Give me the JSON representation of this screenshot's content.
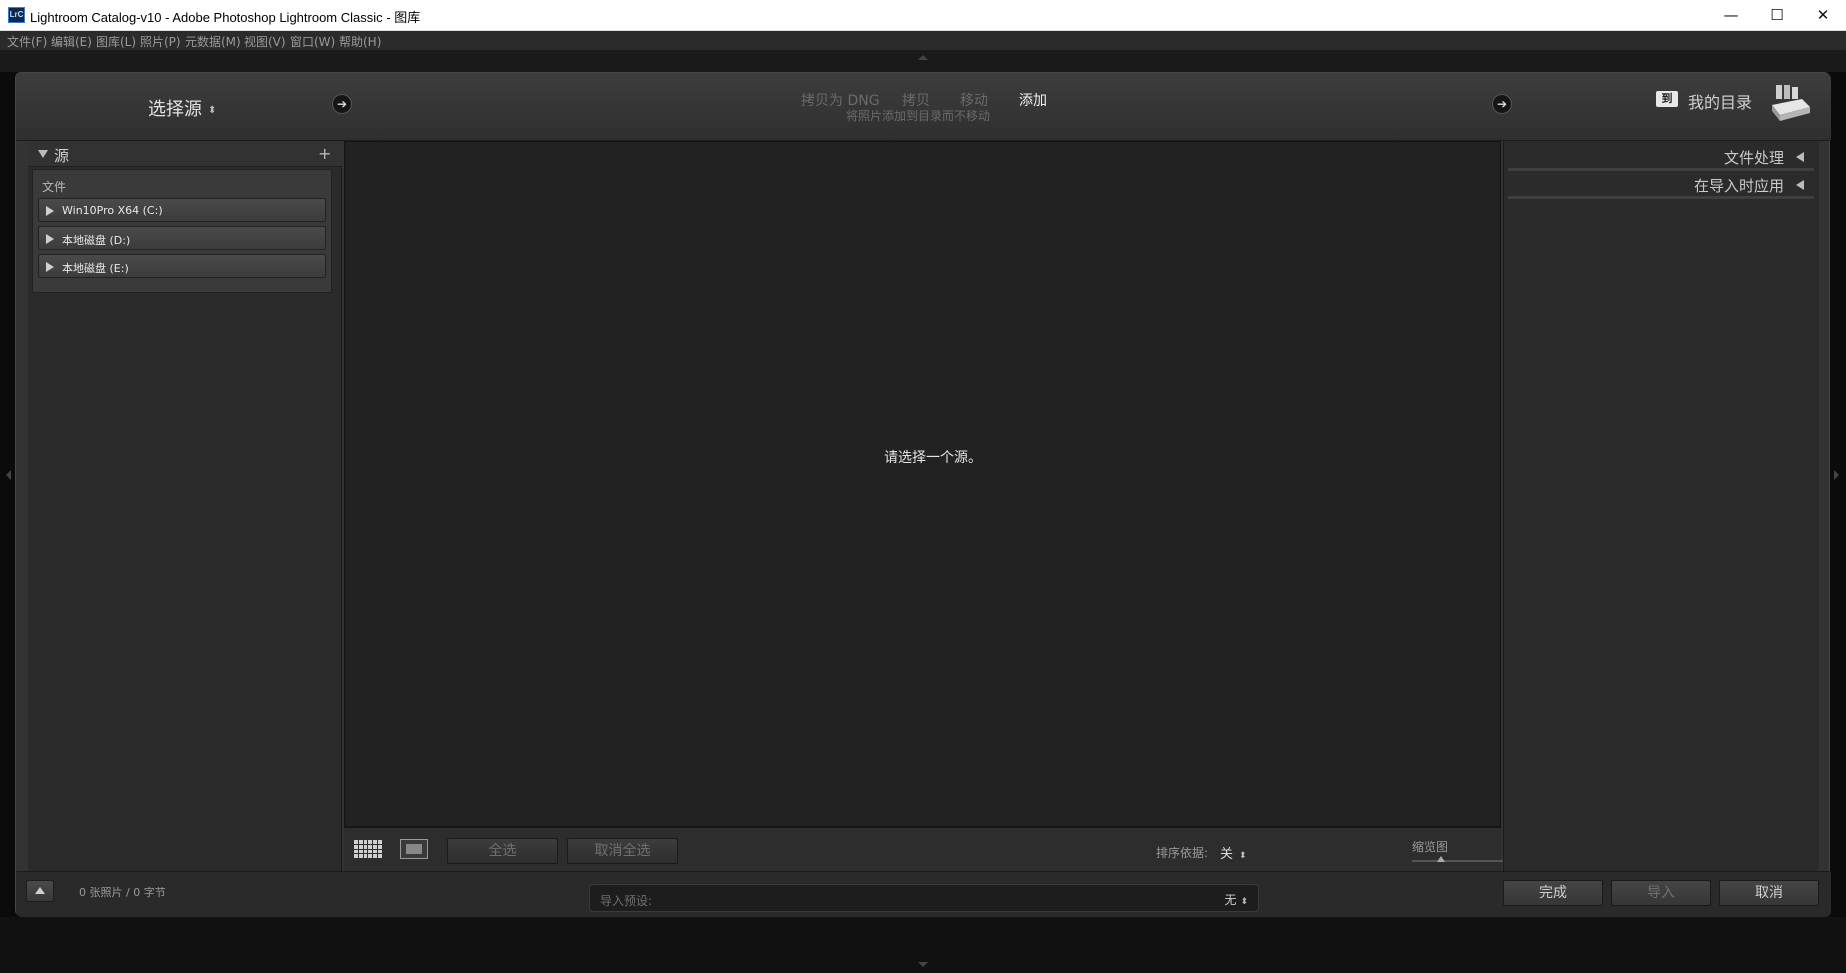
{
  "window": {
    "app_icon_text": "LrC",
    "title": "Lightroom Catalog-v10 - Adobe Photoshop Lightroom Classic - 图库",
    "minimize_glyph": "—",
    "maximize_glyph": "☐",
    "close_glyph": "✕"
  },
  "menu": [
    {
      "label": "文件(F)"
    },
    {
      "label": "编辑(E)"
    },
    {
      "label": "图库(L)"
    },
    {
      "label": "照片(P)"
    },
    {
      "label": "元数据(M)"
    },
    {
      "label": "视图(V)"
    },
    {
      "label": "窗口(W)"
    },
    {
      "label": "帮助(H)"
    }
  ],
  "header": {
    "source_title": "选择源",
    "source_updown": "⬍",
    "arrow_glyph": "➔",
    "modes": {
      "dng": "拷贝为 DNG",
      "copy": "拷贝",
      "move": "移动",
      "add": "添加"
    },
    "mode_description": "将照片添加到目录而不移动",
    "catalog_badge": "到",
    "catalog_label": "我的目录"
  },
  "left_panel": {
    "title": "源",
    "plus": "+",
    "files_label": "文件",
    "drives": [
      {
        "name": "Win10Pro X64 (C:)"
      },
      {
        "name": "本地磁盘 (D:)"
      },
      {
        "name": "本地磁盘 (E:)"
      }
    ]
  },
  "center": {
    "empty_message": "请选择一个源。"
  },
  "toolbar": {
    "select_all": "全选",
    "deselect_all": "取消全选",
    "sort_label": "排序依据:",
    "sort_value": "关",
    "sort_updown": "⬍",
    "thumbnail_label": "缩览图",
    "thumbnail_size_fraction": 0.3
  },
  "right_panel": {
    "sections": [
      {
        "title": "文件处理"
      },
      {
        "title": "在导入时应用"
      }
    ]
  },
  "footer": {
    "status": "0 张照片 / 0 字节",
    "preset_label": "导入预设:",
    "preset_value": "无",
    "preset_updown": "⬍",
    "done": "完成",
    "import": "导入",
    "cancel": "取消"
  },
  "colors": {
    "accent_active": "#f0f0f0",
    "inactive_text": "#6a6a6a",
    "panel_bg": "#2b2b2b",
    "center_bg": "#222222"
  }
}
